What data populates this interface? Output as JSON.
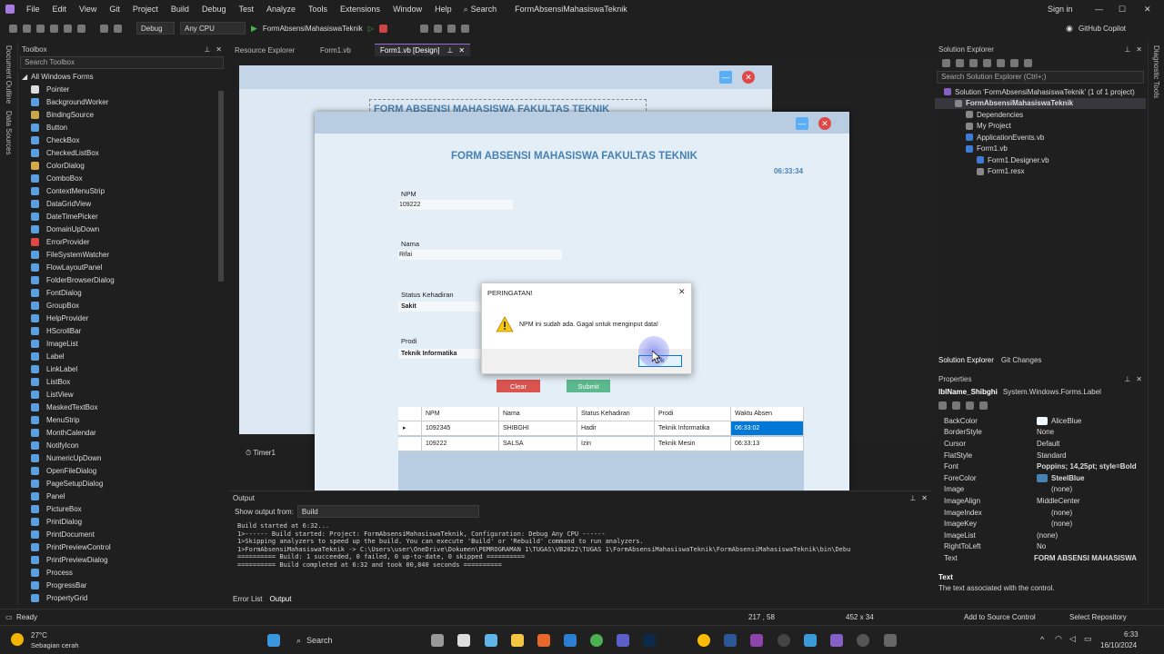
{
  "menu": {
    "items": [
      "File",
      "Edit",
      "View",
      "Git",
      "Project",
      "Build",
      "Debug",
      "Test",
      "Analyze",
      "Tools",
      "Extensions",
      "Window",
      "Help"
    ],
    "search": "Search",
    "project_title": "FormAbsensiMahasiswaTeknik",
    "sign_in": "Sign in",
    "copilot": "GitHub Copilot"
  },
  "toolbar": {
    "config": "Debug",
    "platform": "Any CPU",
    "start_target": "FormAbsensiMahasiswaTeknik"
  },
  "left_strip": {
    "tabs": [
      "Document Outline",
      "Data Sources"
    ]
  },
  "toolbox": {
    "title": "Toolbox",
    "search_placeholder": "Search Toolbox",
    "group": "All Windows Forms",
    "items": [
      "Pointer",
      "BackgroundWorker",
      "BindingSource",
      "Button",
      "CheckBox",
      "CheckedListBox",
      "ColorDialog",
      "ComboBox",
      "ContextMenuStrip",
      "DataGridView",
      "DateTimePicker",
      "DomainUpDown",
      "ErrorProvider",
      "FileSystemWatcher",
      "FlowLayoutPanel",
      "FolderBrowserDialog",
      "FontDialog",
      "GroupBox",
      "HelpProvider",
      "HScrollBar",
      "ImageList",
      "Label",
      "LinkLabel",
      "ListBox",
      "ListView",
      "MaskedTextBox",
      "MenuStrip",
      "MonthCalendar",
      "NotifyIcon",
      "NumericUpDown",
      "OpenFileDialog",
      "PageSetupDialog",
      "Panel",
      "PictureBox",
      "PrintDialog",
      "PrintDocument",
      "PrintPreviewControl",
      "PrintPreviewDialog",
      "Process",
      "ProgressBar",
      "PropertyGrid"
    ]
  },
  "doc_tabs": [
    "Resource Explorer",
    "Form1.vb",
    "Form1.vb [Design]"
  ],
  "designer": {
    "title_text": "FORM ABSENSI MAHASISWA FAKULTAS TEKNIK",
    "timer_component": "Timer1"
  },
  "app": {
    "title": "FORM ABSENSI MAHASISWA FAKULTAS TEKNIK",
    "clock": "06:33:34",
    "npm_label": "NPM",
    "npm_value": "109222",
    "nama_label": "Nama",
    "nama_value": "Rifai",
    "status_label": "Status Kehadiran",
    "status_value": "Sakit",
    "prodi_label": "Prodi",
    "prodi_value": "Teknik Informatika",
    "clear_button": "Clear",
    "submit_button": "Submit",
    "grid": {
      "columns": [
        "NPM",
        "Nama",
        "Status Kehadiran",
        "Prodi",
        "Waktu Absen"
      ],
      "rows": [
        [
          "1092345",
          "SHIBGHI",
          "Hadir",
          "Teknik Informatika",
          "06:33:02"
        ],
        [
          "109222",
          "SALSA",
          "Izin",
          "Teknik Mesin",
          "06:33:13"
        ]
      ]
    }
  },
  "dialog": {
    "title": "PERINGATAN!",
    "message": "NPM ini sudah ada. Gagal untuk menginput data!",
    "ok_button": "Ok"
  },
  "output": {
    "title": "Output",
    "show_from_label": "Show output from:",
    "show_from_value": "Build",
    "lines": [
      "Build started at 6:32...",
      "1>------ Build started: Project: FormAbsensiMahasiswaTeknik, Configuration: Debug Any CPU ------",
      "1>Skipping analyzers to speed up the build. You can execute 'Build' or 'Rebuild' command to run analyzers.",
      "1>FormAbsensiMahasiswaTeknik -> C:\\Users\\user\\OneDrive\\Dokumen\\PEMROGRAMAN 1\\TUGAS\\VB2022\\TUGAS 1\\FormAbsensiMahasiswaTeknik\\FormAbsensiMahasiswaTeknik\\bin\\Debu",
      "========== Build: 1 succeeded, 0 failed, 0 up-to-date, 0 skipped ==========",
      "========== Build completed at 6:32 and took 00,840 seconds =========="
    ],
    "tabs": [
      "Error List",
      "Output"
    ]
  },
  "solution": {
    "title": "Solution Explorer",
    "search_placeholder": "Search Solution Explorer (Ctrl+;)",
    "items": [
      {
        "label": "Solution 'FormAbsensiMahasiswaTeknik' (1 of 1 project)",
        "level": 0
      },
      {
        "label": "FormAbsensiMahasiswaTeknik",
        "level": 1
      },
      {
        "label": "Dependencies",
        "level": 2
      },
      {
        "label": "My Project",
        "level": 2
      },
      {
        "label": "ApplicationEvents.vb",
        "level": 2
      },
      {
        "label": "Form1.vb",
        "level": 2
      },
      {
        "label": "Form1.Designer.vb",
        "level": 3
      },
      {
        "label": "Form1.resx",
        "level": 3
      }
    ],
    "tabs": [
      "Solution Explorer",
      "Git Changes"
    ]
  },
  "properties": {
    "title": "Properties",
    "object_name": "lblName_Shibghi",
    "object_type": "System.Windows.Forms.Label",
    "rows": [
      {
        "key": "BackColor",
        "value": "AliceBlue",
        "swatch": "#f0f8ff"
      },
      {
        "key": "BorderStyle",
        "value": "None"
      },
      {
        "key": "Cursor",
        "value": "Default"
      },
      {
        "key": "FlatStyle",
        "value": "Standard"
      },
      {
        "key": "Font",
        "value": "Poppins; 14,25pt; style=Bold"
      },
      {
        "key": "ForeColor",
        "value": "SteelBlue",
        "swatch": "#4682b4"
      },
      {
        "key": "Image",
        "value": "(none)",
        "swatch": "#1f1f1f"
      },
      {
        "key": "ImageAlign",
        "value": "MiddleCenter"
      },
      {
        "key": "ImageIndex",
        "value": "(none)",
        "swatch": "#1f1f1f"
      },
      {
        "key": "ImageKey",
        "value": "(none)",
        "swatch": "#1f1f1f"
      },
      {
        "key": "ImageList",
        "value": "(none)"
      },
      {
        "key": "RightToLeft",
        "value": "No"
      },
      {
        "key": "Text",
        "value": "FORM ABSENSI MAHASISWA"
      }
    ],
    "desc_title": "Text",
    "desc_body": "The text associated with the control."
  },
  "statusbar": {
    "ready": "Ready",
    "coords": "217 , 58",
    "size": "452 x 34",
    "add_source": "Add to Source Control",
    "select_repo": "Select Repository"
  },
  "taskbar": {
    "temp": "27°C",
    "weather": "Sebagian cerah",
    "search": "Search",
    "time": "6:33",
    "date": "16/10/2024"
  },
  "colors": {
    "steelblue": "#4682b4",
    "clear_button": "#d9534f",
    "submit_button": "#5cb88d",
    "grid_selection": "#0078d7"
  }
}
